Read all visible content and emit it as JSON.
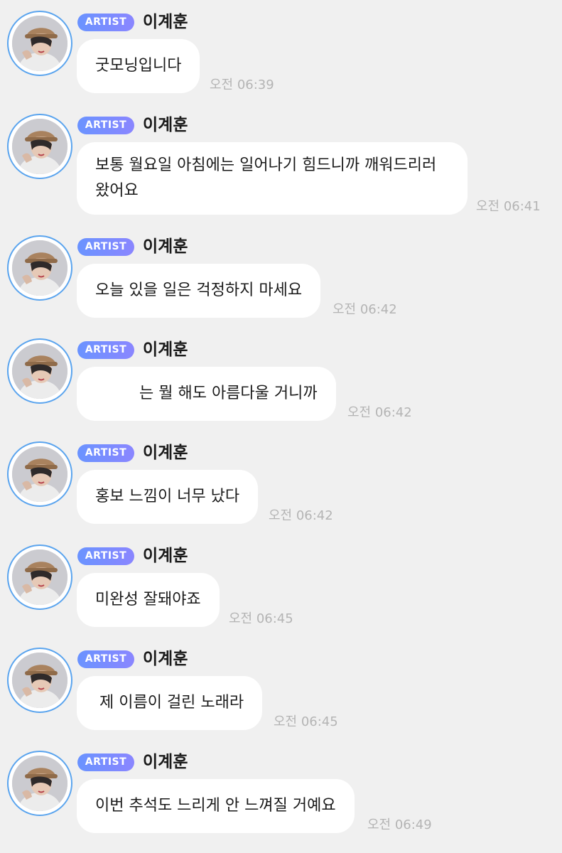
{
  "artist_badge": "ARTIST",
  "messages": [
    {
      "name": "이계훈",
      "text": "굿모닝입니다",
      "time": "오전 06:39"
    },
    {
      "name": "이계훈",
      "text": "보통 월요일 아침에는 일어나기 힘드니까 깨워드리러 왔어요",
      "time": "오전 06:41"
    },
    {
      "name": "이계훈",
      "text": "오늘 있을 일은 걱정하지 마세요",
      "time": "오전 06:42"
    },
    {
      "name": "이계훈",
      "text": "는 뭘 해도 아름다울 거니까",
      "time": "오전 06:42"
    },
    {
      "name": "이계훈",
      "text": "홍보 느낌이 너무 났다",
      "time": "오전 06:42"
    },
    {
      "name": "이계훈",
      "text": "미완성 잘돼야죠",
      "time": "오전 06:45"
    },
    {
      "name": "이계훈",
      "text": "제 이름이 걸린 노래라",
      "time": "오전 06:45"
    },
    {
      "name": "이계훈",
      "text": "이번 추석도 느리게 안 느껴질 거예요",
      "time": "오전 06:49"
    }
  ],
  "colors": {
    "background": "#f0f0f0",
    "bubble": "#ffffff",
    "badge_start": "#6a93ff",
    "badge_end": "#8a86ff",
    "avatar_ring": "#5aa4ee",
    "timestamp": "#b4b4b4"
  },
  "icons": {
    "avatar": "profile-photo"
  }
}
